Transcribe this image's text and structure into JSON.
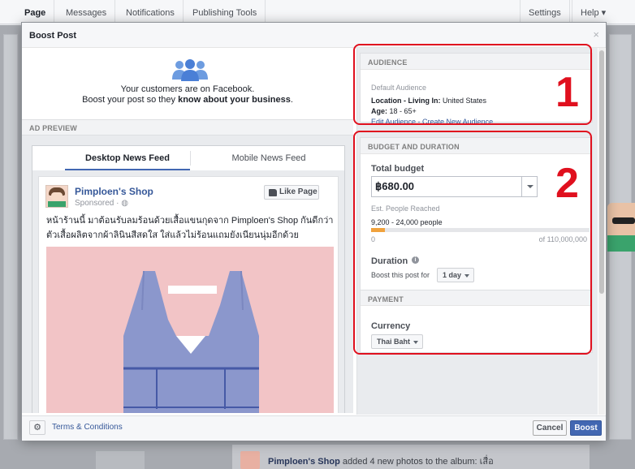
{
  "topnav": {
    "items": [
      "Page",
      "Messages",
      "Notifications",
      "Publishing Tools"
    ],
    "settings": "Settings",
    "help": "Help ▾"
  },
  "modal": {
    "title": "Boost Post",
    "close": "×",
    "hero": {
      "line1": "Your customers are on Facebook.",
      "line2_prefix": "Boost your post so they ",
      "line2_bold": "know about your business",
      "line2_suffix": "."
    },
    "ad_preview_label": "AD PREVIEW",
    "tabs": [
      "Desktop News Feed",
      "Mobile News Feed"
    ],
    "post": {
      "page_name": "Pimploen's Shop",
      "sponsored": "Sponsored · ◍",
      "like_button": "Like Page",
      "text": "หน้าร้านนี้ มาต้อนรับลมร้อนด้วยเสื้อแขนกุดจาก Pimploen's Shop กันดีกว่า ตัวเสื้อผลิตจากผ้าลินินสีสดใส ใส่แล้วไม่ร้อนแถมยังเนียนนุ่มอีกด้วย"
    },
    "audience": {
      "header": "AUDIENCE",
      "default": "Default Audience",
      "location_label": "Location - Living In:",
      "location_value": " United States",
      "age_label": "Age:",
      "age_value": " 18 - 65+",
      "edit_link": "Edit Audience",
      "sep": " - ",
      "create_link": "Create New Audience"
    },
    "budget": {
      "header": "BUDGET AND DURATION",
      "total_label": "Total budget",
      "value": "฿680.00",
      "est_label": "Est. People Reached",
      "est_range": "9,200 - 24,000 people",
      "reach_fraction": 0.064,
      "min": "0",
      "max": "of 110,000,000",
      "duration_label": "Duration",
      "duration_sub": "Boost this post for",
      "duration_value": "1 day"
    },
    "payment": {
      "header": "PAYMENT",
      "currency_label": "Currency",
      "currency_value": "Thai Baht"
    },
    "footer": {
      "terms": "Terms & Conditions",
      "cancel": "Cancel",
      "boost": "Boost"
    }
  },
  "background": {
    "story_name": "Pimploen's Shop",
    "story_text": " added 4 new photos to the album: เสื่อ"
  },
  "annotations": [
    "1",
    "2"
  ],
  "colors": {
    "accent": "#4267b2",
    "annotation": "#e0101e",
    "reach_fill": "#f0a23d"
  }
}
